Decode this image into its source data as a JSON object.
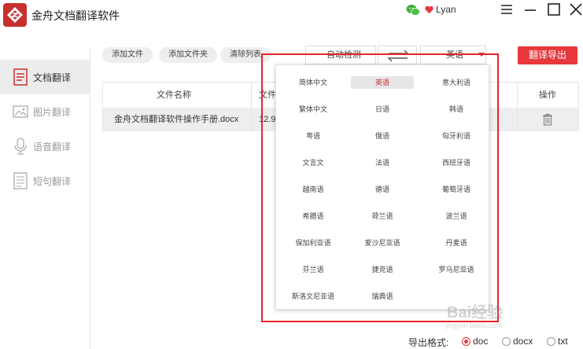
{
  "app": {
    "title": "金舟文档翻译软件",
    "username": "Lyan"
  },
  "sidebar": {
    "items": [
      {
        "label": "文档翻译",
        "icon": "document-icon",
        "active": true
      },
      {
        "label": "图片翻译",
        "icon": "image-icon",
        "active": false
      },
      {
        "label": "语音翻译",
        "icon": "microphone-icon",
        "active": false
      },
      {
        "label": "短句翻译",
        "icon": "text-icon",
        "active": false
      }
    ]
  },
  "toolbar": {
    "add_file": "添加文件",
    "add_folder": "添加文件夹",
    "clear_list": "清除列表",
    "source_language": "自动检测",
    "target_language": "英语",
    "export_button": "翻译导出"
  },
  "table": {
    "headers": {
      "name": "文件名称",
      "size": "文件",
      "action": "操作"
    },
    "rows": [
      {
        "name": "金舟文档翻译软件操作手册.docx",
        "size": "12.9"
      }
    ]
  },
  "dropdown": {
    "selected": "英语",
    "languages": [
      "简体中文",
      "英语",
      "意大利语",
      "繁体中文",
      "日语",
      "韩语",
      "粤语",
      "俄语",
      "匈牙利语",
      "文言文",
      "法语",
      "西班牙语",
      "越南语",
      "德语",
      "葡萄牙语",
      "希腊语",
      "荷兰语",
      "波兰语",
      "保加利亚语",
      "爱沙尼亚语",
      "丹麦语",
      "芬兰语",
      "捷克语",
      "罗马尼亚语",
      "斯洛文尼亚语",
      "瑞典语"
    ]
  },
  "export_format": {
    "label": "导出格式:",
    "options": [
      "doc",
      "docx",
      "txt"
    ],
    "selected": "doc"
  },
  "colors": {
    "brand_red": "#e8373d",
    "logo_red": "#c8302e",
    "highlight_red": "#e8252a"
  },
  "watermark": {
    "text": "Bai经验",
    "subtext": "jingyan.baidu.com"
  }
}
